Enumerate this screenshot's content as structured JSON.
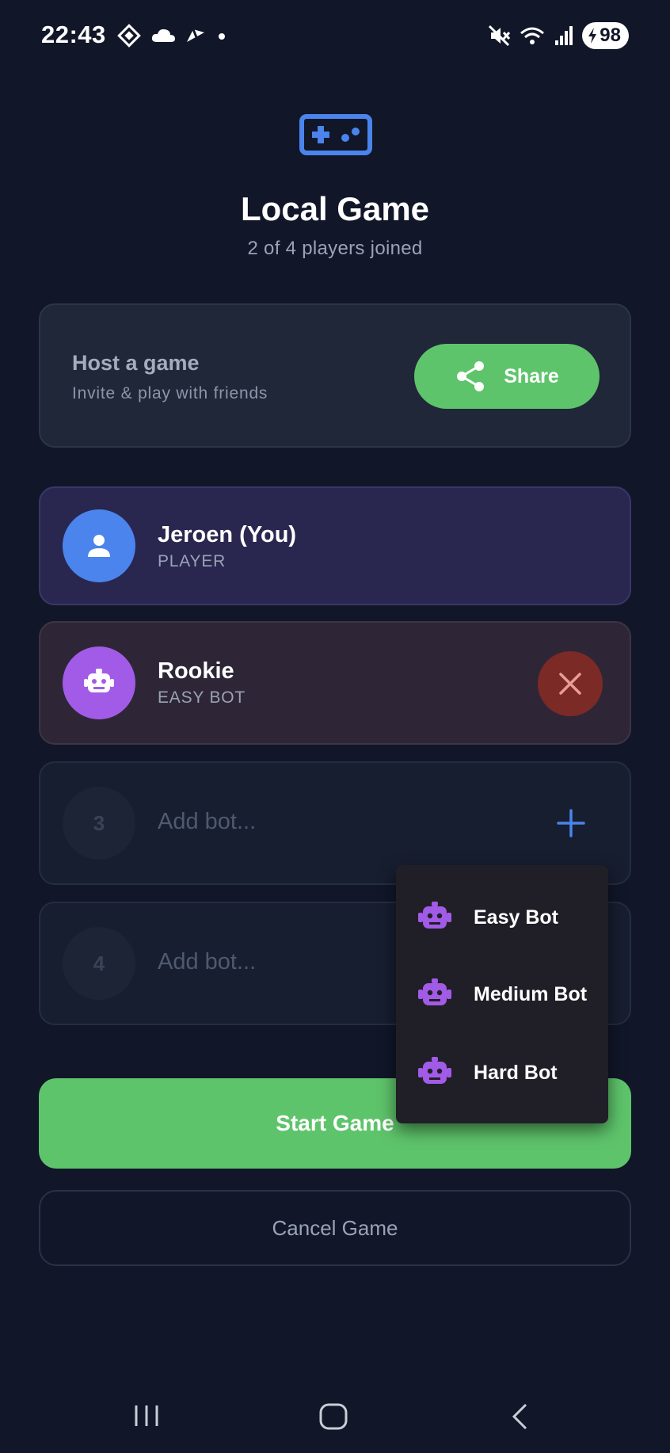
{
  "status_bar": {
    "time": "22:43",
    "battery": "98",
    "icons": [
      "tiktok-icon",
      "cloud-icon",
      "navigation-icon",
      "dot-icon",
      "mute-icon",
      "wifi-icon",
      "signal-icon",
      "battery-icon"
    ]
  },
  "header": {
    "icon": "gamepad-icon",
    "title": "Local Game",
    "subtitle": "2 of 4 players joined"
  },
  "host_card": {
    "title": "Host a game",
    "subtitle": "Invite & play with friends",
    "share_label": "Share"
  },
  "slots": [
    {
      "name": "Jeroen (You)",
      "role": "PLAYER",
      "icon": "person-icon"
    },
    {
      "name": "Rookie",
      "role": "EASY BOT",
      "icon": "robot-icon"
    },
    {
      "number": "3",
      "placeholder": "Add bot..."
    },
    {
      "number": "4",
      "placeholder": "Add bot..."
    }
  ],
  "bot_menu": {
    "items": [
      {
        "label": "Easy Bot",
        "icon": "robot-icon"
      },
      {
        "label": "Medium Bot",
        "icon": "robot-icon"
      },
      {
        "label": "Hard Bot",
        "icon": "robot-icon"
      }
    ]
  },
  "actions": {
    "start_label": "Start Game",
    "cancel_label": "Cancel Game"
  },
  "colors": {
    "background": "#111629",
    "accent_green": "#5ec46b",
    "accent_blue": "#4a84ec",
    "bot_purple": "#a25be6",
    "remove_red": "#7b2a26"
  }
}
